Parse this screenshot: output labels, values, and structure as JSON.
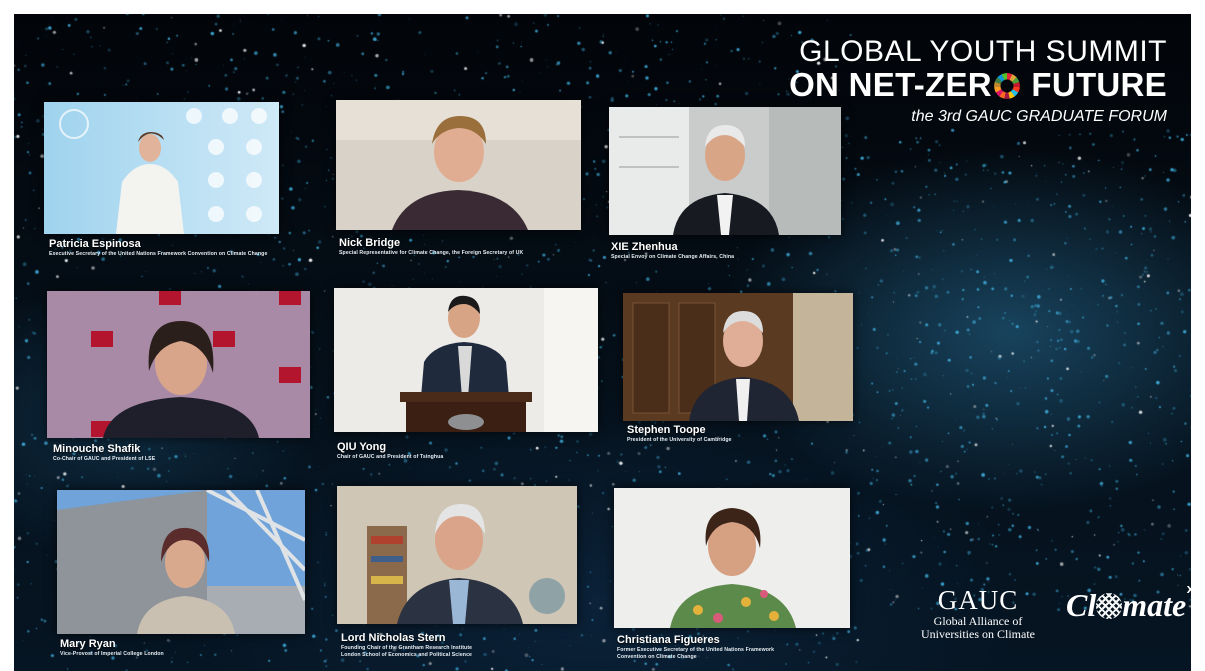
{
  "event": {
    "title_line1": "GLOBAL YOUTH SUMMIT",
    "title_line2_a": "ON NET-ZER",
    "title_line2_b": " FUTURE",
    "subtitle": "the 3rd GAUC GRADUATE FORUM"
  },
  "speakers": [
    {
      "name": "Patricia Espinosa",
      "role": "Executive Secretary of the United Nations Framework Convention on Climate Change"
    },
    {
      "name": "Nick Bridge",
      "role": "Special Representative for Climate Change, the Foreign Secretary of UK"
    },
    {
      "name": "XIE Zhenhua",
      "role": "Special Envoy on Climate Change Affairs, China"
    },
    {
      "name": "Minouche Shafik",
      "role": "Co-Chair of GAUC and President of LSE"
    },
    {
      "name": "QIU Yong",
      "role": "Chair of GAUC and President of Tsinghua"
    },
    {
      "name": "Stephen Toope",
      "role": "President of the University of Cambridge"
    },
    {
      "name": "Mary Ryan",
      "role": "Vice-Provost of Imperial College London"
    },
    {
      "name": "Lord Nicholas Stern",
      "role": "Founding Chair of the Grantham Research Institute",
      "role2": "London School of Economics and Political Science"
    },
    {
      "name": "Christiana Figueres",
      "role": "Former Executive Secretary of the United Nations Framework",
      "role2": "Convention on Climate Change"
    }
  ],
  "logos": {
    "gauc_mark": "GAUC",
    "gauc_line1": "Global Alliance of",
    "gauc_line2": "Universities on Climate",
    "climate_a": "Cl",
    "climate_b": "mate",
    "climate_x": "x"
  },
  "colors": {
    "background": "#03070d",
    "particles": "#3fa9d6",
    "text": "#ffffff"
  }
}
